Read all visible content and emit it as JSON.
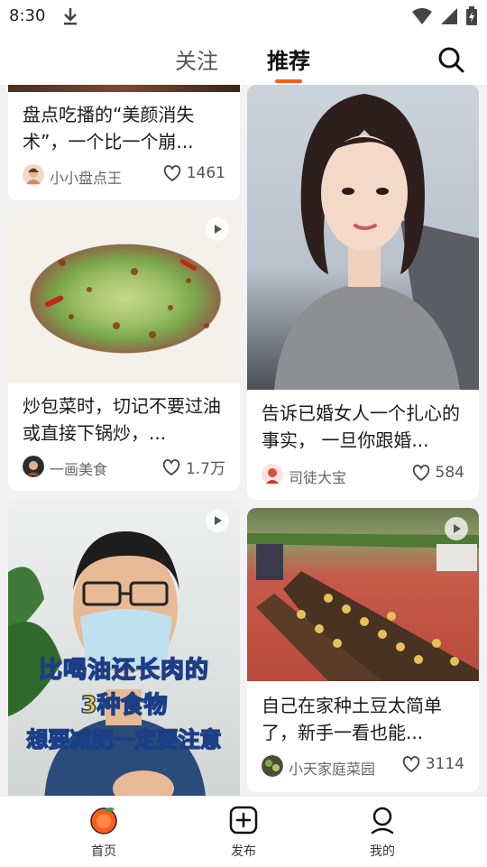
{
  "status_bar": {
    "time": "8:30"
  },
  "top_nav": {
    "tabs": [
      {
        "label": "关注",
        "active": false
      },
      {
        "label": "推荐",
        "active": true
      }
    ],
    "accent": "#ff5a1f"
  },
  "feed": {
    "cards": [
      {
        "title": "盘点吃播的“美颜消失术”，一个比一个崩...",
        "author": "小小盘点王",
        "likes": "1461",
        "has_play": false
      },
      {
        "title": "炒包菜时，切记不要过油或直接下锅炒，...",
        "author": "一画美食",
        "likes": "1.7万",
        "has_play": true
      },
      {
        "title": "",
        "author": "",
        "likes": "",
        "has_play": true,
        "overlay_text": [
          "比喝油还长肉的",
          "3种食物",
          "想要减肥一定要注意"
        ]
      },
      {
        "title": "告诉已婚女人一个扎心的事实， 一旦你跟婚...",
        "author": "司徒大宝",
        "likes": "584",
        "has_play": false
      },
      {
        "title": "自己在家种土豆太简单了，新手一看也能...",
        "author": "小天家庭菜园",
        "likes": "3114",
        "has_play": true
      }
    ]
  },
  "bottom_nav": {
    "items": [
      {
        "label": "首页",
        "icon": "home-orange-icon"
      },
      {
        "label": "发布",
        "icon": "plus-square-icon"
      },
      {
        "label": "我的",
        "icon": "user-icon"
      }
    ]
  }
}
